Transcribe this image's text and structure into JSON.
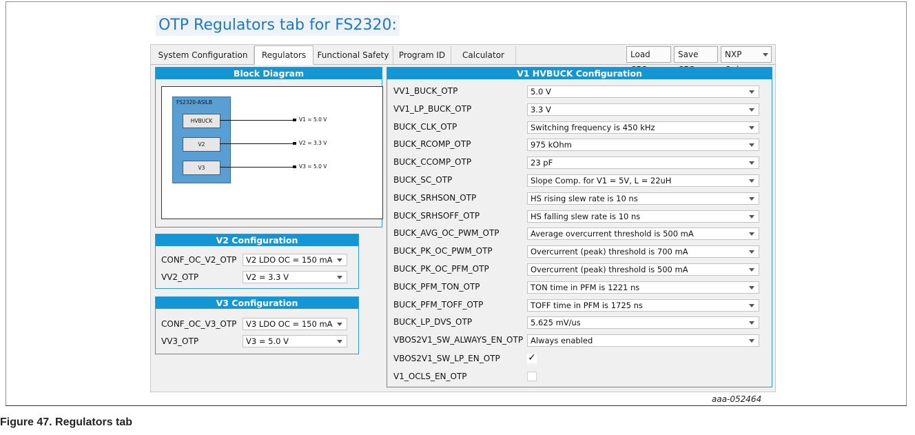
{
  "page_heading": "OTP Regulators tab for FS2320:",
  "tabs": [
    {
      "label": "System Configuration"
    },
    {
      "label": "Regulators"
    },
    {
      "label": "Functional Safety"
    },
    {
      "label": "Program ID"
    },
    {
      "label": "Calculator"
    }
  ],
  "toolbar": {
    "load_cfg": "Load CFG",
    "save_cfg": "Save CFG",
    "nxp_only": "NXP Only"
  },
  "block_diagram": {
    "title": "Block Diagram",
    "chip": "FS2320-ASILB",
    "blocks": [
      {
        "name": "HVBUCK",
        "output": "V1 = 5.0 V"
      },
      {
        "name": "V2",
        "output": "V2 = 3.3 V"
      },
      {
        "name": "V3",
        "output": "V3 = 5.0 V"
      }
    ]
  },
  "v2_config": {
    "title": "V2 Configuration",
    "rows": [
      {
        "label": "CONF_OC_V2_OTP",
        "value": "V2 LDO OC = 150 mA"
      },
      {
        "label": "VV2_OTP",
        "value": "V2 = 3.3 V"
      }
    ]
  },
  "v3_config": {
    "title": "V3 Configuration",
    "rows": [
      {
        "label": "CONF_OC_V3_OTP",
        "value": "V3 LDO OC = 150 mA"
      },
      {
        "label": "VV3_OTP",
        "value": "V3 = 5.0 V"
      }
    ]
  },
  "v1_config": {
    "title": "V1 HVBUCK Configuration",
    "rows": [
      {
        "label": "VV1_BUCK_OTP",
        "value": "5.0 V"
      },
      {
        "label": "VV1_LP_BUCK_OTP",
        "value": "3.3 V"
      },
      {
        "label": "BUCK_CLK_OTP",
        "value": "Switching frequency is 450 kHz"
      },
      {
        "label": "BUCK_RCOMP_OTP",
        "value": "975 kOhm"
      },
      {
        "label": "BUCK_CCOMP_OTP",
        "value": "23 pF"
      },
      {
        "label": "BUCK_SC_OTP",
        "value": "Slope Comp. for V1 = 5V, L = 22uH"
      },
      {
        "label": "BUCK_SRHSON_OTP",
        "value": "HS rising slew rate is 10 ns"
      },
      {
        "label": "BUCK_SRHSOFF_OTP",
        "value": "HS falling slew rate is 10 ns"
      },
      {
        "label": "BUCK_AVG_OC_PWM_OTP",
        "value": "Average overcurrent threshold is 500 mA"
      },
      {
        "label": "BUCK_PK_OC_PWM_OTP",
        "value": "Overcurrent (peak) threshold is 700 mA"
      },
      {
        "label": "BUCK_PK_OC_PFM_OTP",
        "value": "Overcurrent (peak) threshold is 500 mA"
      },
      {
        "label": "BUCK_PFM_TON_OTP",
        "value": "TON time in PFM is 1221 ns"
      },
      {
        "label": "BUCK_PFM_TOFF_OTP",
        "value": "TOFF time in PFM is 1725 ns"
      },
      {
        "label": "BUCK_LP_DVS_OTP",
        "value": "5.625 mV/us"
      },
      {
        "label": "VBOS2V1_SW_ALWAYS_EN_OTP",
        "value": "Always enabled"
      }
    ],
    "checkboxes": [
      {
        "label": "VBOS2V1_SW_LP_EN_OTP",
        "mark": "✓"
      },
      {
        "label": "V1_OCLS_EN_OTP",
        "mark": ""
      }
    ]
  },
  "figure_id": "aaa-052464",
  "caption": "Figure 47.  Regulators tab"
}
